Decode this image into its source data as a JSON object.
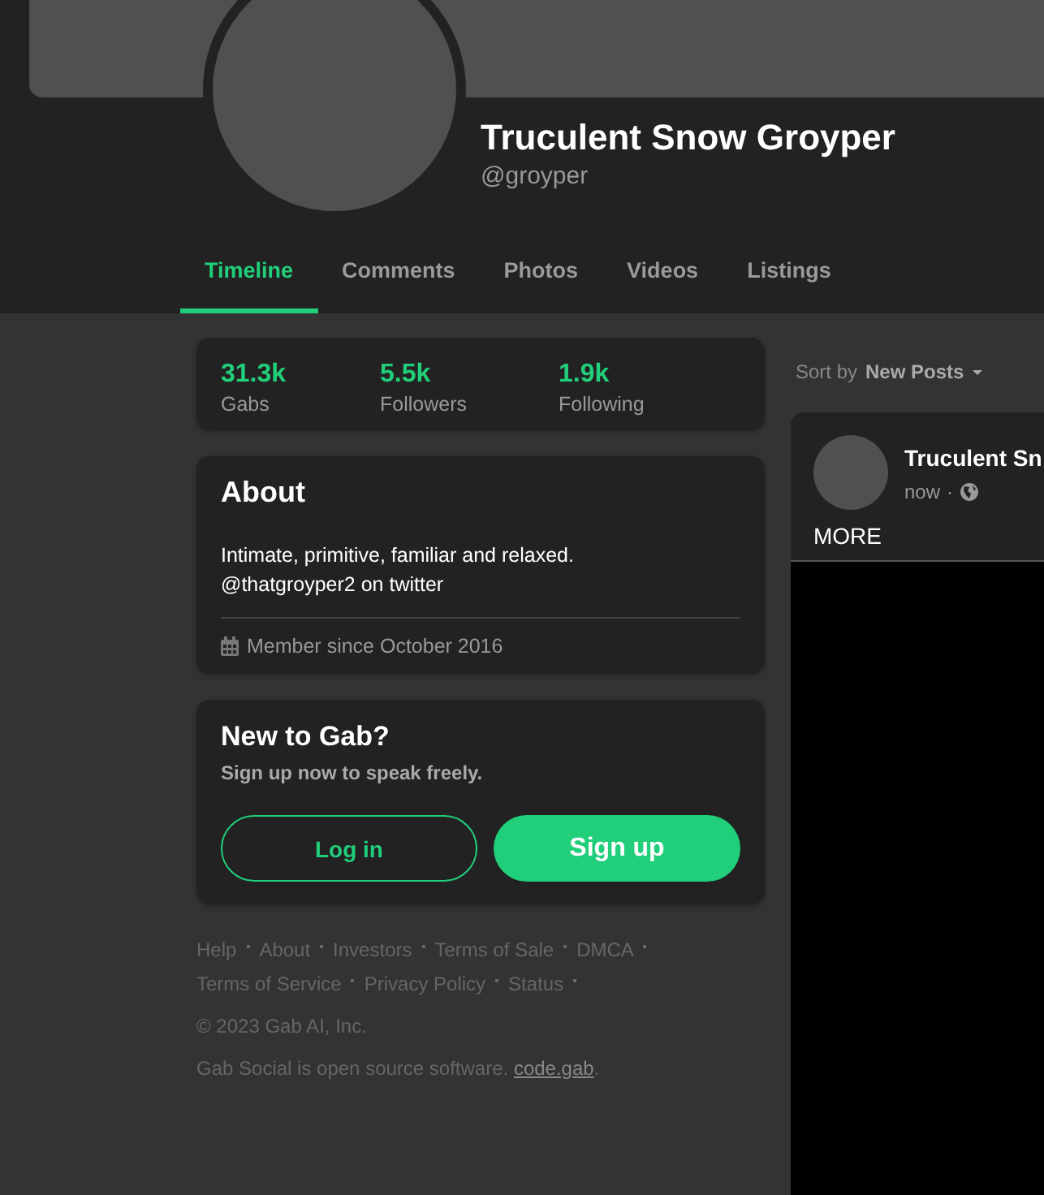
{
  "profile": {
    "name": "Truculent Snow Groyper",
    "handle": "@groyper"
  },
  "tabs": [
    {
      "label": "Timeline",
      "selected": true
    },
    {
      "label": "Comments",
      "selected": false
    },
    {
      "label": "Photos",
      "selected": false
    },
    {
      "label": "Videos",
      "selected": false
    },
    {
      "label": "Listings",
      "selected": false
    }
  ],
  "stats": [
    {
      "value": "31.3k",
      "label": "Gabs"
    },
    {
      "value": "5.5k",
      "label": "Followers"
    },
    {
      "value": "1.9k",
      "label": "Following"
    }
  ],
  "about": {
    "title": "About",
    "bio": [
      "Intimate, primitive, familiar and relaxed.",
      "@thatgroyper2 on twitter"
    ],
    "member_since": "Member since October 2016"
  },
  "signup_card": {
    "title": "New to Gab?",
    "subtitle": "Sign up now to speak freely.",
    "buttons": [
      {
        "label": "Log in",
        "kind": "outline"
      },
      {
        "label": "Sign up",
        "kind": "filled"
      }
    ]
  },
  "footer": {
    "links": [
      "Help",
      "About",
      "Investors",
      "Terms of Sale",
      "DMCA",
      "Terms of Service",
      "Privacy Policy",
      "Status"
    ],
    "copyright": "© 2023 Gab AI, Inc.",
    "source_text": "Gab Social is open source software.",
    "source_link": "code.gab",
    "source_end": "."
  },
  "feed": {
    "sort_label": "Sort by",
    "sort_value": "New Posts",
    "post": {
      "author": "Truculent Sn",
      "time": "now",
      "separator": "·",
      "body": "MORE"
    }
  }
}
